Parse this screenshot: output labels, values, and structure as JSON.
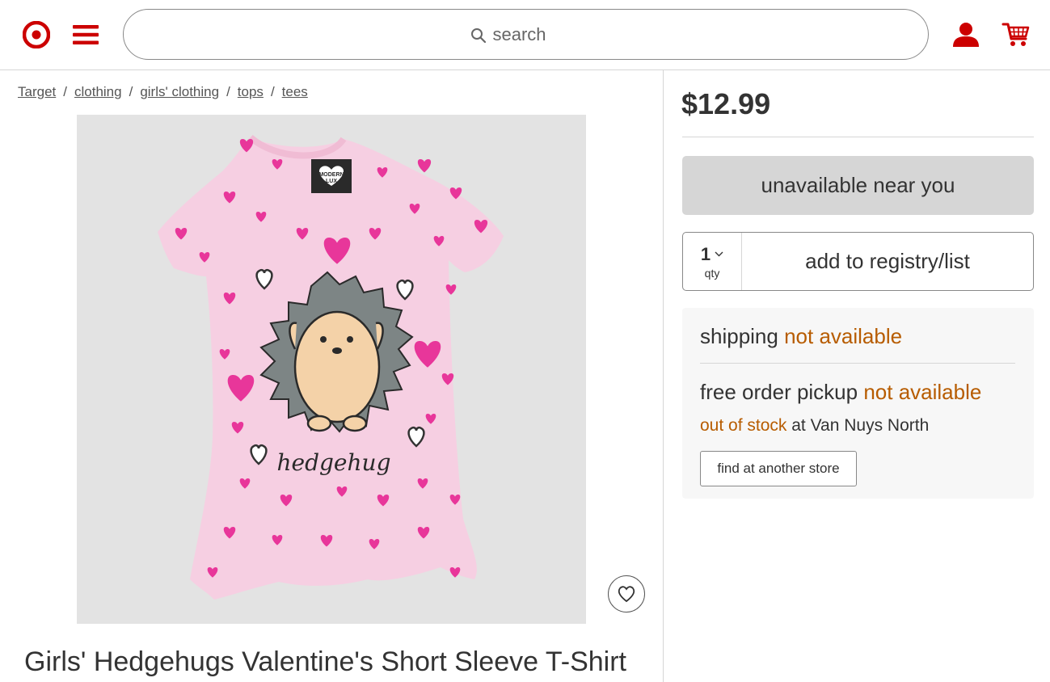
{
  "header": {
    "search_placeholder": "search",
    "icons": {
      "logo": "target-bullseye-logo",
      "menu": "hamburger-menu-icon",
      "search": "magnifier-icon",
      "account": "person-icon",
      "cart": "cart-icon"
    },
    "brand_color": "#cc0000"
  },
  "breadcrumb": {
    "items": [
      "Target",
      "clothing",
      "girls' clothing",
      "tops",
      "tees"
    ],
    "separator": "/"
  },
  "product": {
    "title": "Girls' Hedgehugs Valentine's Short Sleeve T-Shirt",
    "price": "$12.99",
    "image": {
      "garment_color": "#f6cfe2",
      "heart_color": "#e8369a",
      "background": "#e3e3e3",
      "tag_text_1": "MODERN",
      "tag_text_2": "LUX",
      "print_text": "hedgehug"
    }
  },
  "actions": {
    "unavailable_label": "unavailable near you",
    "qty_value": "1",
    "qty_label": "qty",
    "registry_label": "add to registry/list"
  },
  "fulfillment": {
    "shipping_label": "shipping",
    "shipping_status": "not available",
    "pickup_label": "free order pickup",
    "pickup_status": "not available",
    "stock_status": "out of stock",
    "stock_location": "at Van Nuys North",
    "find_store_label": "find at another store",
    "status_color": "#b75c00"
  }
}
